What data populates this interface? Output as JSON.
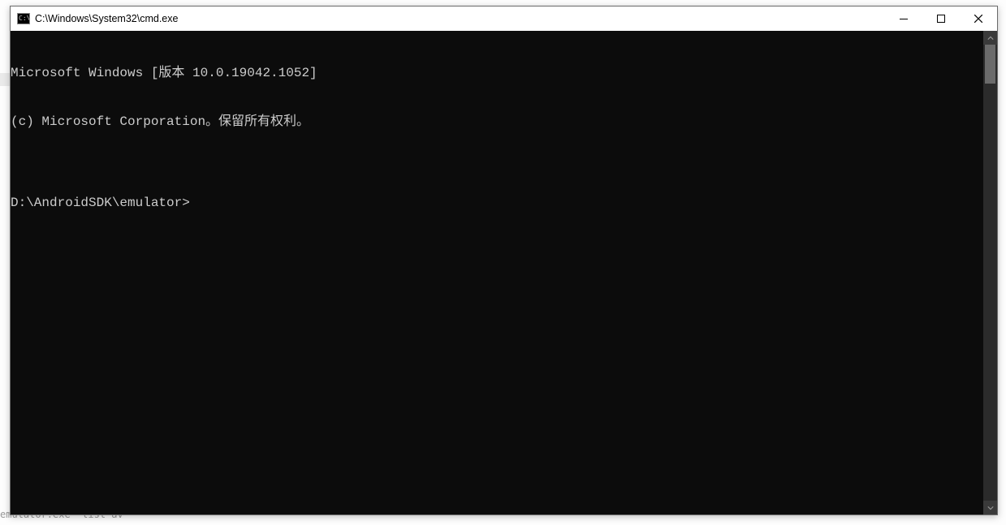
{
  "window": {
    "title": "C:\\Windows\\System32\\cmd.exe",
    "icon_name": "cmd-icon"
  },
  "controls": {
    "minimize_name": "minimize-icon",
    "maximize_name": "maximize-icon",
    "close_name": "close-icon"
  },
  "terminal": {
    "lines": [
      "Microsoft Windows [版本 10.0.19042.1052]",
      "(c) Microsoft Corporation。保留所有权利。",
      "",
      "D:\\AndroidSDK\\emulator>"
    ]
  },
  "background": {
    "partial_text": "emulator.exe -list-av"
  }
}
